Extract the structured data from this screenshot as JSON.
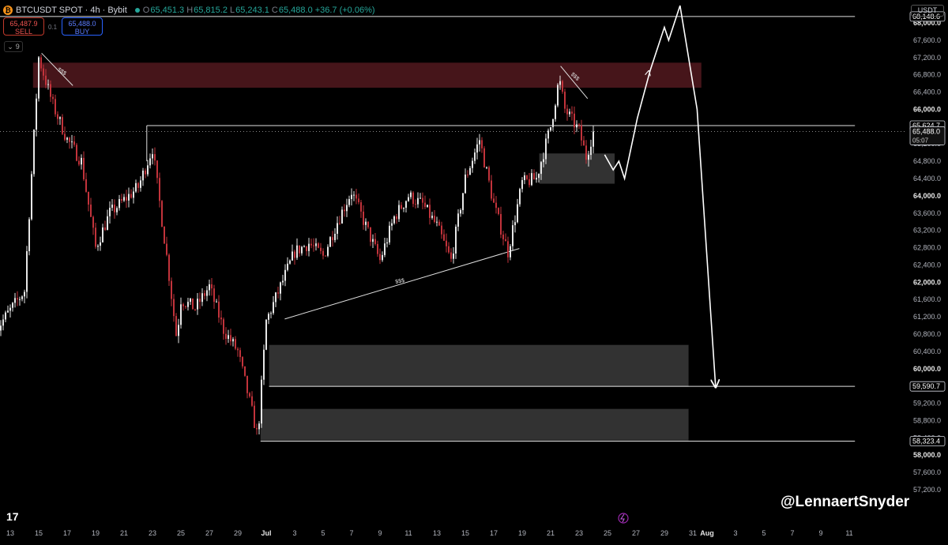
{
  "header": {
    "coin_icon": "bitcoin-icon",
    "symbol": "BTCUSDT SPOT · 4h · Bybit",
    "open_label": "O",
    "open": "65,451.3",
    "high_label": "H",
    "high": "65,815.2",
    "low_label": "L",
    "low": "65,243.1",
    "close_label": "C",
    "close": "65,488.0",
    "change": "+36.7 (+0.06%)"
  },
  "trade": {
    "sell_price": "65,487.9",
    "sell_label": "SELL",
    "buy_price": "65,488.0",
    "buy_label": "BUY",
    "spread": "0.1"
  },
  "indicators": {
    "icon": "chevron-down-icon",
    "count": "9"
  },
  "currency": "USDT",
  "watermark": "@LennaertSnyder",
  "colors": {
    "up": "#e6e6e6",
    "down": "#c2333b",
    "zone_red": "#4a161b",
    "zone_gray": "#3b3b3b",
    "annotation": "#ffffff"
  },
  "chart_data": {
    "type": "candlestick",
    "title": "",
    "xlabel": "",
    "ylabel": "",
    "ylim": [
      56900,
      68400
    ],
    "x_ticks": [
      "13",
      "15",
      "17",
      "19",
      "21",
      "23",
      "25",
      "27",
      "29",
      "Jul",
      "3",
      "5",
      "7",
      "9",
      "11",
      "13",
      "15",
      "17",
      "19",
      "21",
      "23",
      "25",
      "27",
      "29",
      "31",
      "Aug",
      "3",
      "5",
      "7",
      "9",
      "11"
    ],
    "y_ticks": [
      "57,200.0",
      "57,600.0",
      "58,000.0",
      "58,400.0",
      "58,800.0",
      "59,200.0",
      "59,600.0",
      "60,000.0",
      "60,400.0",
      "60,800.0",
      "61,200.0",
      "61,600.0",
      "62,000.0",
      "62,400.0",
      "62,800.0",
      "63,200.0",
      "63,600.0",
      "64,000.0",
      "64,400.0",
      "64,800.0",
      "65,200.0",
      "65,600.0",
      "66,000.0",
      "66,400.0",
      "66,800.0",
      "67,200.0",
      "67,600.0",
      "68,000.0"
    ],
    "bold_y_ticks": [
      "58,000.0",
      "60,000.0",
      "62,000.0",
      "64,000.0",
      "66,000.0",
      "68,000.0"
    ],
    "price_labels": [
      {
        "text": "68,148.6",
        "value": 68148.6,
        "style": "outline"
      },
      {
        "text": "65,624.7",
        "value": 65624.7,
        "style": "outline"
      },
      {
        "text": "65,488.0",
        "value": 65488.0,
        "style": "last",
        "countdown": "05:07"
      },
      {
        "text": "59,590.7",
        "value": 59590.7,
        "style": "outline"
      },
      {
        "text": "58,323.4",
        "value": 58323.4,
        "style": "outline"
      }
    ],
    "path": [
      [
        "Jun 12",
        60900
      ],
      [
        "Jun 14",
        61800
      ],
      [
        "Jun 15",
        67200
      ],
      [
        "Jun 16",
        66100
      ],
      [
        "Jun 17",
        65300
      ],
      [
        "Jun 18",
        64800
      ],
      [
        "Jun 19",
        62800
      ],
      [
        "Jun 20",
        63600
      ],
      [
        "Jun 21",
        63900
      ],
      [
        "Jun 22",
        64200
      ],
      [
        "Jun 23",
        65100
      ],
      [
        "Jun 24",
        62600
      ],
      [
        "Jun 24.7",
        60700
      ],
      [
        "Jun 25",
        61600
      ],
      [
        "Jun 26",
        61400
      ],
      [
        "Jun 27",
        61900
      ],
      [
        "Jun 28",
        60900
      ],
      [
        "Jun 29",
        60400
      ],
      [
        "Jun 30",
        59000
      ],
      [
        "Jun 30.4",
        58400
      ],
      [
        "Jul 1",
        61100
      ],
      [
        "Jul 2",
        61900
      ],
      [
        "Jul 3",
        62700
      ],
      [
        "Jul 4",
        62900
      ],
      [
        "Jul 5",
        62600
      ],
      [
        "Jul 6",
        63400
      ],
      [
        "Jul 7",
        64100
      ],
      [
        "Jul 8",
        63300
      ],
      [
        "Jul 9",
        62500
      ],
      [
        "Jul 10",
        63500
      ],
      [
        "Jul 11",
        64000
      ],
      [
        "Jul 12",
        63800
      ],
      [
        "Jul 13",
        63300
      ],
      [
        "Jul 14",
        62500
      ],
      [
        "Jul 15",
        64400
      ],
      [
        "Jul 16",
        65300
      ],
      [
        "Jul 17",
        63800
      ],
      [
        "Jul 18",
        62700
      ],
      [
        "Jul 19",
        64300
      ],
      [
        "Jul 20",
        64400
      ],
      [
        "Jul 21",
        65600
      ],
      [
        "Jul 21.6",
        66700
      ],
      [
        "Jul 22",
        66000
      ],
      [
        "Jul 23",
        65500
      ],
      [
        "Jul 23.5",
        64900
      ],
      [
        "Jul 24",
        65488
      ]
    ],
    "zones": [
      {
        "kind": "red",
        "from": "Jun 14.6",
        "to": "Aug 0.6",
        "low": 66500,
        "high": 67080
      },
      {
        "kind": "gray",
        "from": "Jul 20.2",
        "to": "Jul 25.5",
        "low": 64280,
        "high": 64980
      },
      {
        "kind": "gray",
        "from": "Jul 1.2",
        "to": "Jul 30.7",
        "low": 59580,
        "high": 60550
      },
      {
        "kind": "gray",
        "from": "Jun 30.6",
        "to": "Jul 30.7",
        "low": 58340,
        "high": 59070
      }
    ],
    "annotations": [
      {
        "text": "$$$",
        "x": "Jun 16.3",
        "y": 66900,
        "angle": 33
      },
      {
        "text": "$$$",
        "x": "Jul 22.4",
        "y": 66800,
        "angle": 42
      },
      {
        "text": "$$$",
        "x": "Jul 10.1",
        "y": 61970,
        "angle": -10
      }
    ],
    "lines": [
      {
        "kind": "trendline",
        "from": [
          "Jun 15.2",
          67300
        ],
        "to": [
          "Jun 17.4",
          66550
        ]
      },
      {
        "kind": "trendline",
        "from": [
          "Jul 21.7",
          67000
        ],
        "to": [
          "Jul 23.6",
          66250
        ]
      },
      {
        "kind": "trendline",
        "from": [
          "Jul 2.3",
          61150
        ],
        "to": [
          "Jul 18.8",
          62780
        ]
      },
      {
        "kind": "level",
        "from": [
          "Jun 22.6",
          65624.7
        ],
        "to": [
          "Aug 11.4",
          65624.7
        ]
      },
      {
        "kind": "level",
        "from": [
          "Jun 22.6",
          65624.7
        ],
        "to": [
          "Jun 22.6",
          64800
        ]
      },
      {
        "kind": "level",
        "from": [
          "Jun 12",
          68148.6
        ],
        "to": [
          "Aug 11.4",
          68148.6
        ]
      },
      {
        "kind": "level",
        "from": [
          "Jul 1.2",
          59590.7
        ],
        "to": [
          "Aug 11.4",
          59590.7
        ]
      },
      {
        "kind": "level",
        "from": [
          "Jun 30.6",
          58323.4
        ],
        "to": [
          "Aug 11.4",
          58323.4
        ]
      }
    ],
    "projection": [
      [
        "Jul 24.8",
        64950
      ],
      [
        "Jul 25.4",
        64600
      ],
      [
        "Jul 25.8",
        64800
      ],
      [
        "Jul 26.2",
        64400
      ],
      [
        "Jul 27.1",
        65800
      ],
      [
        "Jul 28",
        66900
      ],
      [
        "Jul 29",
        67900
      ],
      [
        "Jul 29.3",
        67600
      ],
      [
        "Jul 30.1",
        68400
      ],
      [
        "Jul 31.3",
        66000
      ],
      [
        "Aug 1.6",
        59590
      ]
    ]
  }
}
